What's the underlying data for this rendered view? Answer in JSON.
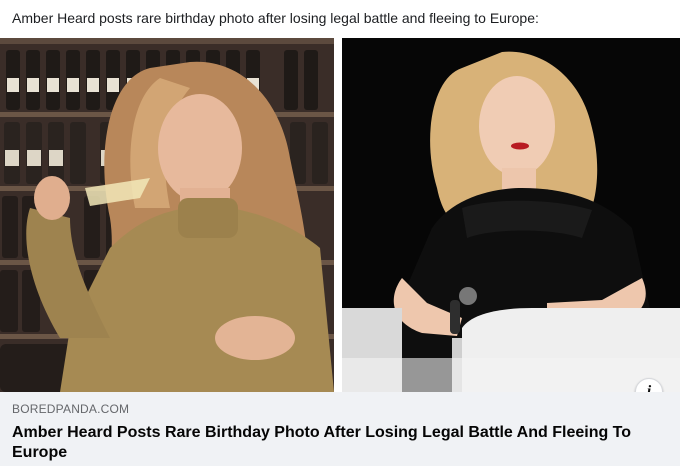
{
  "post": {
    "text": "Amber Heard posts rare birthday photo after losing legal battle and fleeing to Europe:"
  },
  "link_card": {
    "domain": "BOREDPANDA.COM",
    "headline": "Amber Heard Posts Rare Birthday Photo After Losing Legal Battle And Fleeing To Europe",
    "info_icon": "i"
  },
  "images": {
    "left_icon": "photo-woman-wine-cellar",
    "right_icon": "photo-woman-black-dress-stage"
  }
}
